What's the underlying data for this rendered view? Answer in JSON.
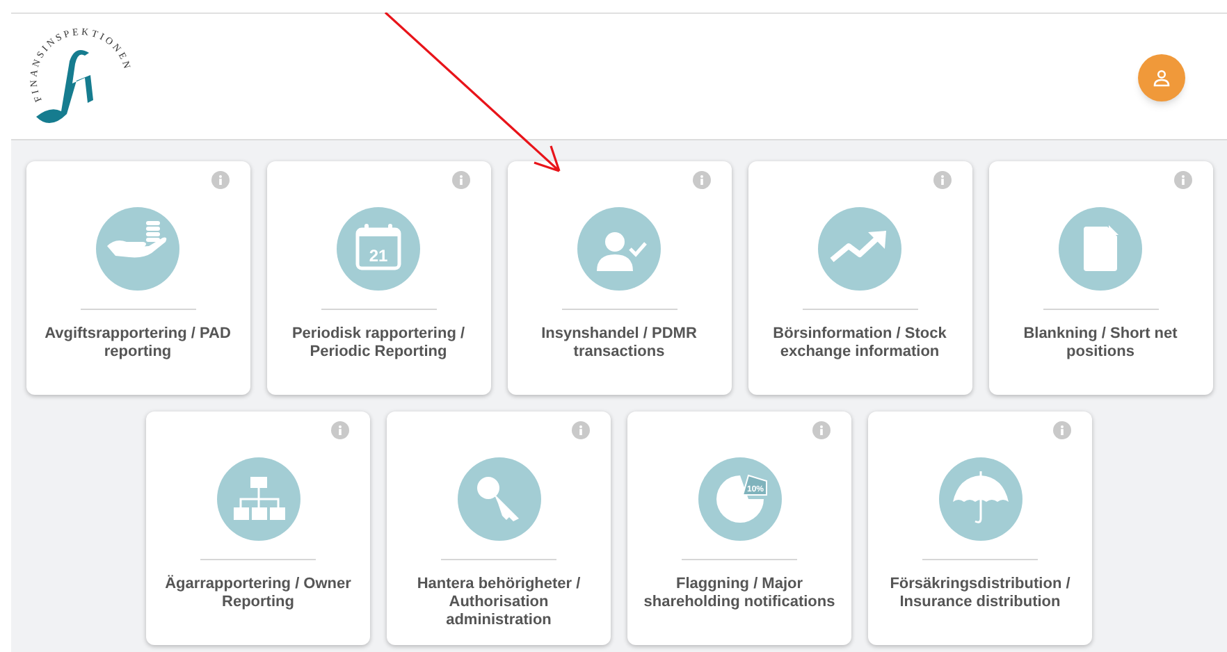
{
  "header": {
    "logo_text": "FINANSINSPEKTIONEN"
  },
  "rows": [
    [
      {
        "title": "Avgiftsrapportering / PAD reporting"
      },
      {
        "icon_text": "21",
        "title": "Periodisk rapportering / Periodic Reporting"
      },
      {
        "title": "Insynshandel / PDMR transactions"
      },
      {
        "title": "Börsinformation / Stock exchange information"
      },
      {
        "title": "Blankning / Short net positions"
      }
    ],
    [
      {
        "title": "Ägarrapportering / Owner Reporting"
      },
      {
        "title": "Hantera behörigheter / Authorisation administration"
      },
      {
        "icon_text": "10%",
        "title": "Flaggning / Major shareholding notifications"
      },
      {
        "title": "Försäkringsdistribution / Insurance distribution"
      }
    ]
  ]
}
